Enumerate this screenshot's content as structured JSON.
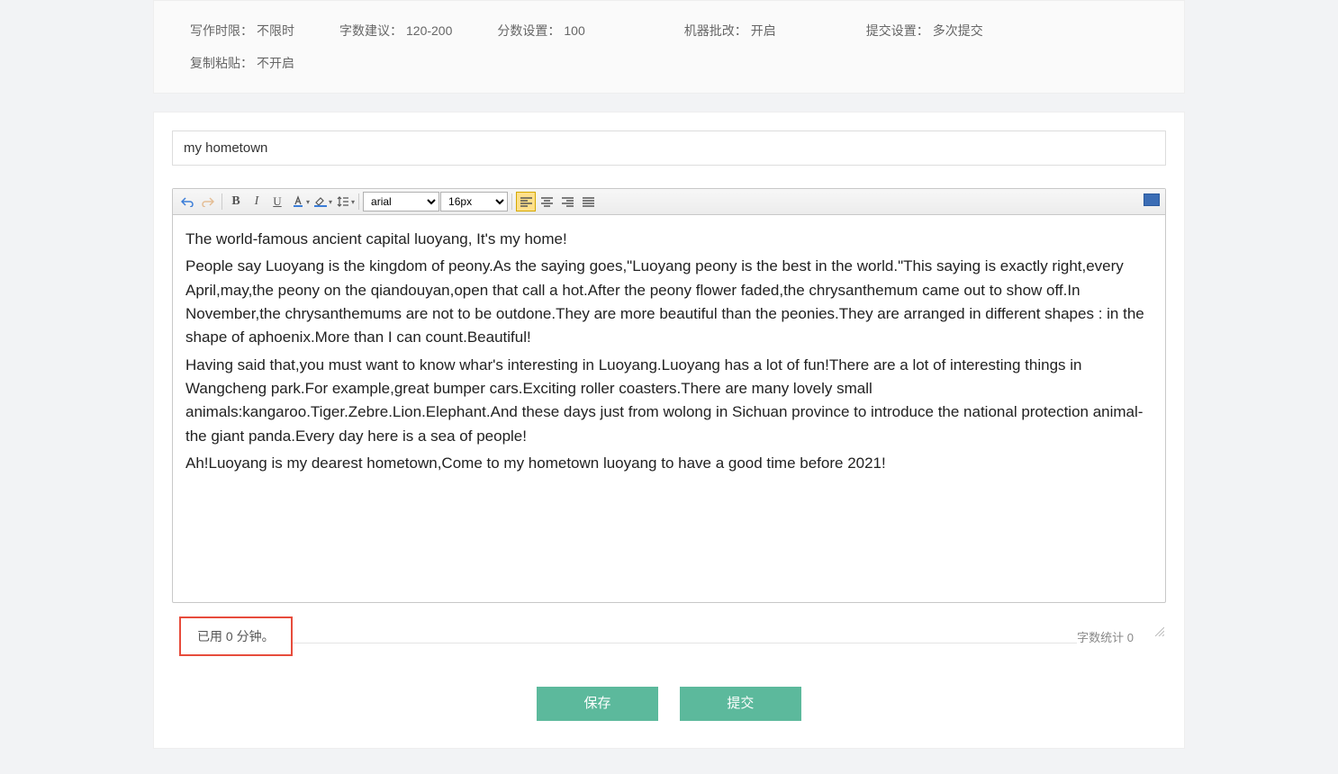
{
  "settings": {
    "time_limit": {
      "label": "写作时限：",
      "value": "不限时"
    },
    "word_suggest": {
      "label": "字数建议：",
      "value": "120-200"
    },
    "score": {
      "label": "分数设置：",
      "value": "100"
    },
    "auto_grade": {
      "label": "机器批改：",
      "value": "开启"
    },
    "submit": {
      "label": "提交设置：",
      "value": "多次提交"
    },
    "copy_paste": {
      "label": "复制粘贴：",
      "value": "不开启"
    }
  },
  "title": "my hometown",
  "toolbar": {
    "font": "arial",
    "size": "16px"
  },
  "content": {
    "p1": "The world-famous ancient capital luoyang, It's my home!",
    "p2": "People say Luoyang is the kingdom of peony.As the saying goes,\"Luoyang peony is the best in the world.\"This saying is exactly right,every April,may,the peony on the qiandouyan,open that call a hot.After the peony flower faded,the chrysanthemum came out to show off.In November,the chrysanthemums are not to be outdone.They are more beautiful than the peonies.They are arranged in different shapes : in the shape of aphoenix.More than I can count.Beautiful!",
    "p3": "Having said that,you must want to know whar's interesting in Luoyang.Luoyang has a lot of fun!There are a lot of interesting things in Wangcheng park.For example,great bumper cars.Exciting roller coasters.There are many lovely small animals:kangaroo.Tiger.Zebre.Lion.Elephant.And these days just from wolong in Sichuan province to introduce the national protection animal- the giant panda.Every day here is a sea of people!",
    "p4": "Ah!Luoyang is my dearest hometown,Come to my hometown  luoyang to have a good time before 2021!"
  },
  "footer": {
    "time_used": "已用 0 分钟。",
    "word_count": "字数统计 0"
  },
  "buttons": {
    "save": "保存",
    "submit": "提交"
  }
}
